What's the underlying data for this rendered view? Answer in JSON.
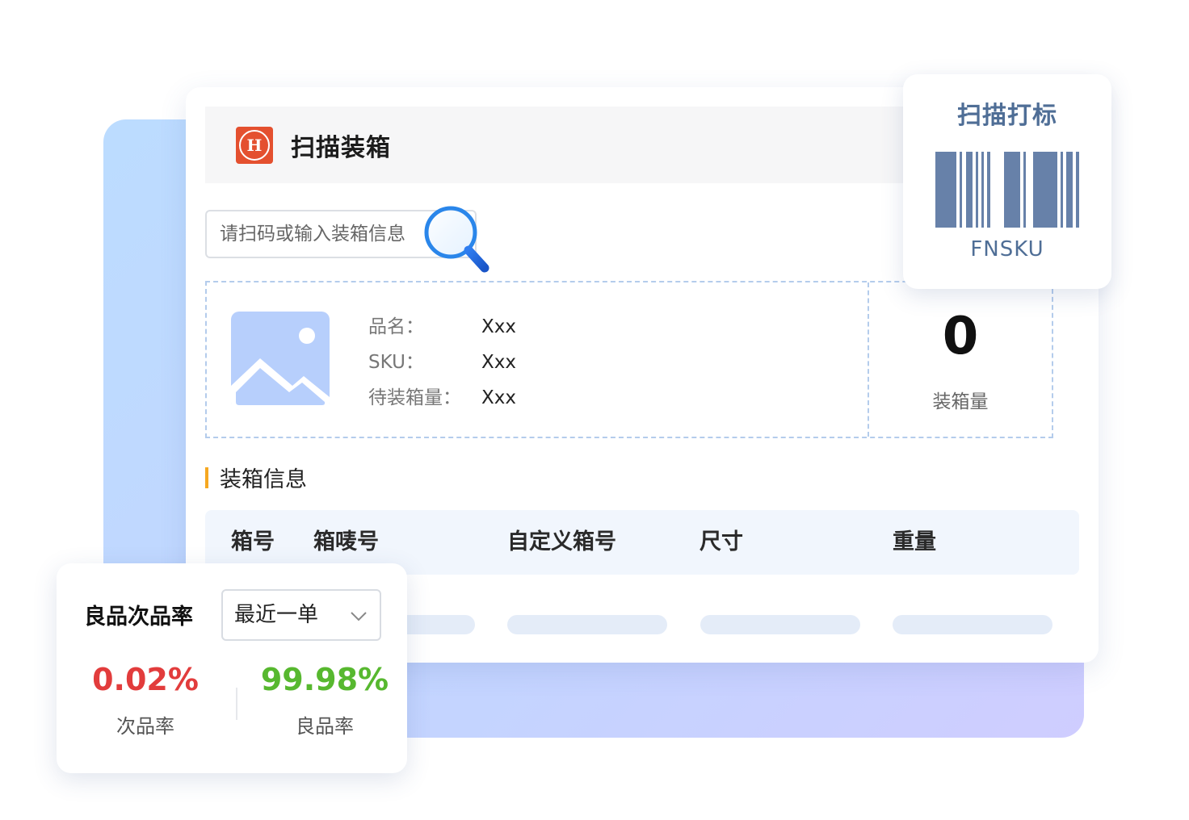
{
  "header": {
    "title": "扫描装箱"
  },
  "search": {
    "placeholder": "请扫码或输入装箱信息"
  },
  "product": {
    "fields": [
      {
        "label": "品名：",
        "value": "Xxx"
      },
      {
        "label": "SKU：",
        "value": "Xxx"
      },
      {
        "label": "待装箱量：",
        "value": "Xxx"
      }
    ],
    "count": "0",
    "count_label": "装箱量"
  },
  "section": {
    "title": "装箱信息"
  },
  "table": {
    "columns": [
      "箱号",
      "箱唛号",
      "自定义箱号",
      "尺寸",
      "重量"
    ]
  },
  "barcode_card": {
    "title": "扫描打标",
    "label": "FNSKU"
  },
  "rate_card": {
    "title": "良品次品率",
    "select_value": "最近一单",
    "defect_rate": "0.02%",
    "defect_label": "次品率",
    "good_rate": "99.98%",
    "good_label": "良品率"
  },
  "colors": {
    "accent_blue": "#4f6e96",
    "defect_red": "#e23c3c",
    "good_green": "#57b82f",
    "section_marker": "#f6a821",
    "logo_red": "#e4502f"
  },
  "icons": [
    "logo-icon",
    "magnifier-icon",
    "image-placeholder-icon",
    "barcode-icon",
    "chevron-down-icon"
  ]
}
